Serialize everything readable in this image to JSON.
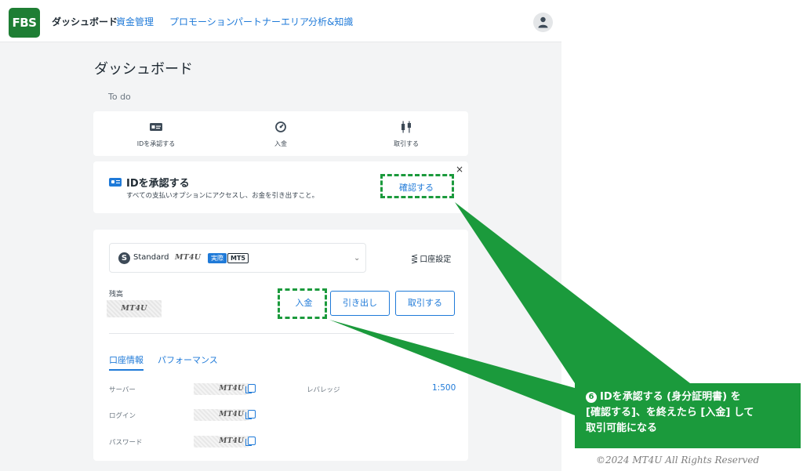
{
  "header": {
    "logo_text": "FBS",
    "nav": [
      {
        "label": "ダッシュボード",
        "active": true
      },
      {
        "label": "資金管理"
      },
      {
        "label": "プロモーション"
      },
      {
        "label": "パートナーエリア"
      },
      {
        "label": "分析&知識"
      }
    ]
  },
  "page_title": "ダッシュボード",
  "todo": {
    "section_label": "To do",
    "items": [
      {
        "label": "IDを承認する",
        "icon": "id-card-icon"
      },
      {
        "label": "入金",
        "icon": "deposit-icon"
      },
      {
        "label": "取引する",
        "icon": "candlestick-icon"
      }
    ]
  },
  "verify": {
    "title": "IDを承認する",
    "description": "すべての支払いオプションにアクセスし、お金を引き出すこと。",
    "button": "確認する",
    "close": "×"
  },
  "account": {
    "icon_letter": "S",
    "type": "Standard",
    "number_mask": "MT4U",
    "badge_real": "実際",
    "badge_platform": "MT5",
    "settings_label": "口座設定",
    "balance_label": "残高",
    "balance_mask": "MT4U",
    "buttons": {
      "deposit": "入金",
      "withdraw": "引き出し",
      "trade": "取引する"
    },
    "tabs": [
      "口座情報",
      "パフォーマンス"
    ],
    "info": {
      "server_label": "サーバー",
      "server_mask": "MT4U",
      "login_label": "ログイン",
      "login_mask": "MT4U",
      "password_label": "パスワード",
      "password_mask": "MT4U",
      "leverage_label": "レバレッジ",
      "leverage_value": "1:500"
    }
  },
  "annotation": {
    "number": "6",
    "line1": "IDを承認する (身分証明書) を",
    "line2": "[確認する]、を終えたら [入金] して",
    "line3": "取引可能になる",
    "copyright": "©2024 MT4U All Rights Reserved"
  },
  "colors": {
    "accent": "#1f7ad8",
    "brand": "#1e7e34",
    "annotation": "#1b9a3c"
  }
}
